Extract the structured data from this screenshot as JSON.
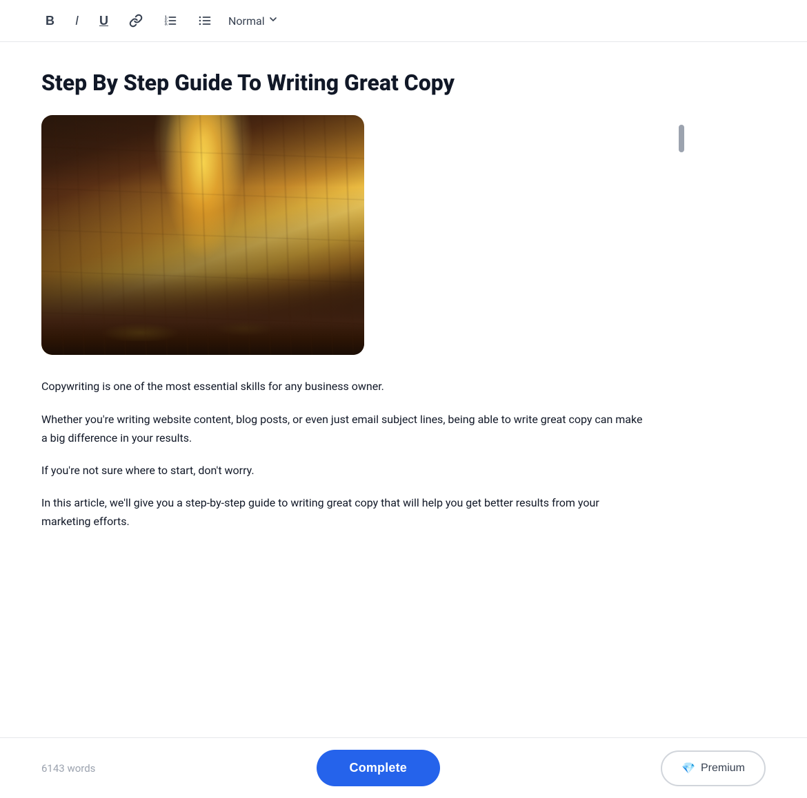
{
  "toolbar": {
    "bold_label": "B",
    "italic_label": "I",
    "underline_label": "U",
    "style_select_label": "Normal",
    "style_select_arrow": "⬦"
  },
  "document": {
    "title": "Step By Step Guide To Writing Great Copy",
    "paragraphs": [
      "Copywriting is one of the most essential skills for any business owner.",
      "Whether you're writing website content, blog posts, or even just email subject lines, being able to write great copy can make a big difference in your results.",
      "If you're not sure where to start, don't worry.",
      "In this article, we'll give you a step-by-step guide to writing great copy that will help you get better results from your marketing efforts."
    ]
  },
  "footer": {
    "word_count": "6143 words",
    "complete_button": "Complete",
    "premium_button": "Premium"
  },
  "icons": {
    "bold": "B",
    "italic": "I",
    "underline": "U",
    "link": "🔗",
    "ordered_list": "≡",
    "unordered_list": "≡",
    "dropdown_arrow": "◆",
    "diamond": "💎"
  }
}
